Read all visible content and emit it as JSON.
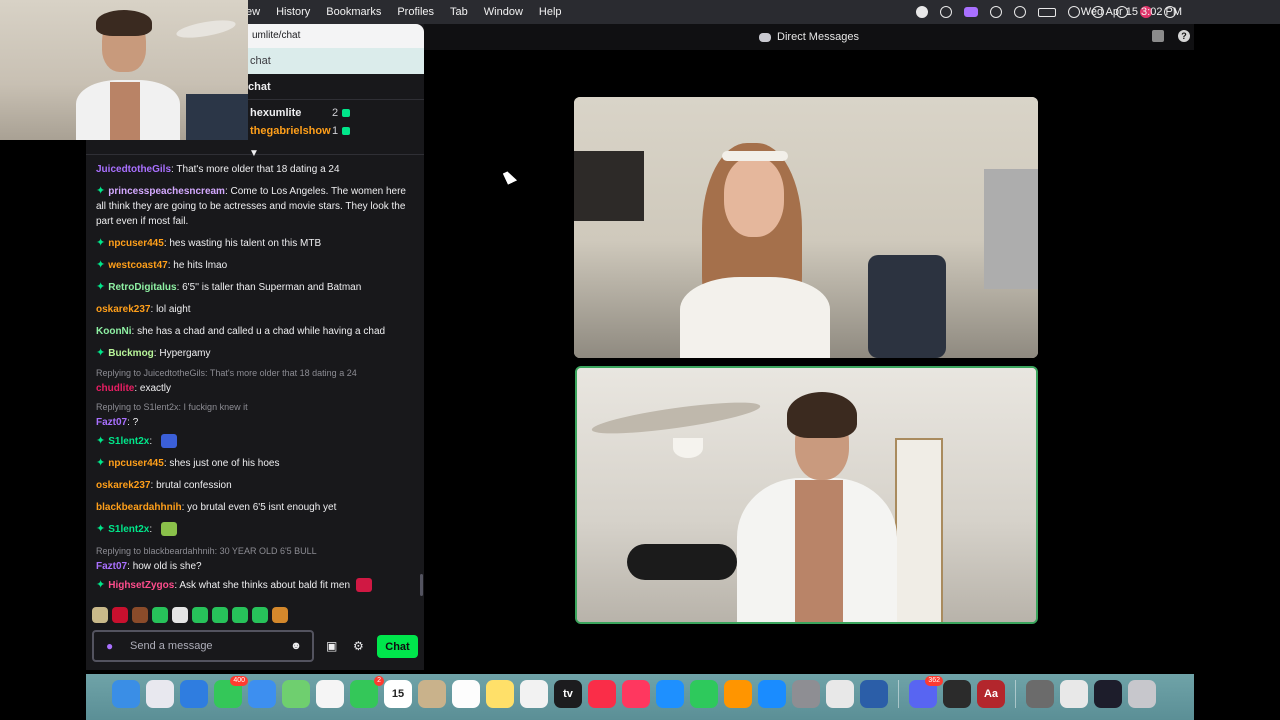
{
  "menubar": {
    "items": [
      "ew",
      "History",
      "Bookmarks",
      "Profiles",
      "Tab",
      "Window",
      "Help"
    ],
    "clock": "Wed Apr 15  3:02 PM"
  },
  "window": {
    "title": "Direct Messages"
  },
  "browser": {
    "address": "umlite/chat",
    "tab_label": "chat",
    "chat_header": "chat"
  },
  "leaderboard": [
    {
      "name": "hexumlite",
      "count": "2",
      "color": "#efeff1"
    },
    {
      "name": "thegabrielshow",
      "count": "1",
      "color": "#ff9f1a"
    }
  ],
  "messages": [
    {
      "author": "JuicedtotheGils",
      "color": "#a970ff",
      "text": "That's more older that 18 dating a 24",
      "badge": false
    },
    {
      "author": "princesspeachesncream",
      "color": "#d4a9ff",
      "text": "Come to Los Angeles. The women here all think they are going to be actresses and movie stars. They look the part even if most fail.",
      "badge": true
    },
    {
      "author": "npcuser445",
      "color": "#ff9f1a",
      "text": "hes wasting his talent on this MTB",
      "badge": true
    },
    {
      "author": "westcoast47",
      "color": "#ff9f1a",
      "text": "he hits lmao",
      "badge": true
    },
    {
      "author": "RetroDigitalus",
      "color": "#8ef0a3",
      "text": "6'5'' is taller than Superman and Batman",
      "badge": true
    },
    {
      "author": "oskarek237",
      "color": "#ff9f1a",
      "text": "lol aight",
      "badge": false
    },
    {
      "author": "KoonNi",
      "color": "#8ef0a3",
      "text": "she has a chad and called u a chad while having a chad",
      "badge": false
    },
    {
      "author": "Buckmog",
      "color": "#b8f59a",
      "text": "Hypergamy",
      "badge": true
    },
    {
      "reply": "Replying to JuicedtotheGils: That's more older that 18 dating a 24",
      "author": "chudlite",
      "color": "#e91e63",
      "text": "exactly",
      "badge": false
    },
    {
      "reply": "Replying to S1lent2x: I fuckign knew it",
      "author": "Fazt07",
      "color": "#a970ff",
      "text": "?",
      "badge": false
    },
    {
      "author": "S1lent2x",
      "color": "#00e68a",
      "text": "",
      "badge": true,
      "emote": "#3b5fd8"
    },
    {
      "author": "npcuser445",
      "color": "#ff9f1a",
      "text": "shes just one of his hoes",
      "badge": true
    },
    {
      "author": "oskarek237",
      "color": "#ff9f1a",
      "text": "brutal confession",
      "badge": false
    },
    {
      "author": "blackbeardahhnih",
      "color": "#ff9f1a",
      "text": "yo brutal even 6'5 isnt enough yet",
      "badge": false
    },
    {
      "author": "S1lent2x",
      "color": "#00e68a",
      "text": "",
      "badge": true,
      "emote": "#8ac04a"
    },
    {
      "reply": "Replying to blackbeardahhnih: 30 YEAR OLD 6'5 BULL",
      "author": "Fazt07",
      "color": "#a970ff",
      "text": "how old is she?",
      "badge": false
    },
    {
      "author": "HighsetZygos",
      "color": "#ff4d8d",
      "text": "Ask what she thinks about bald fit men",
      "badge": true,
      "emote": "#d01843"
    }
  ],
  "emote_row": [
    "#c9b98a",
    "#c8102e",
    "#8a4b2a",
    "#27c25a",
    "#e5e5e5",
    "#27c25a",
    "#27c25a",
    "#27c25a",
    "#27c25a",
    "#d4882c"
  ],
  "chat_input": {
    "placeholder": "Send a message",
    "button_label": "Chat"
  },
  "dock": [
    {
      "name": "finder",
      "color": "#3a8ee6",
      "label": "",
      "badge": ""
    },
    {
      "name": "launchpad",
      "color": "#e8e8ef",
      "label": "",
      "badge": ""
    },
    {
      "name": "safari",
      "color": "#2f7de0",
      "label": "",
      "badge": ""
    },
    {
      "name": "messages",
      "color": "#34c759",
      "label": "",
      "badge": "400"
    },
    {
      "name": "mail",
      "color": "#3d8ff0",
      "label": "",
      "badge": ""
    },
    {
      "name": "maps",
      "color": "#6fcf6f",
      "label": "",
      "badge": ""
    },
    {
      "name": "photos",
      "color": "#f5f5f5",
      "label": "",
      "badge": ""
    },
    {
      "name": "facetime",
      "color": "#34c759",
      "label": "",
      "badge": "2"
    },
    {
      "name": "calendar",
      "color": "#ffffff",
      "label": "15",
      "badge": ""
    },
    {
      "name": "contacts",
      "color": "#c9b28b",
      "label": "",
      "badge": ""
    },
    {
      "name": "reminders",
      "color": "#fdfdfd",
      "label": "",
      "badge": ""
    },
    {
      "name": "notes",
      "color": "#ffe069",
      "label": "",
      "badge": ""
    },
    {
      "name": "freeform",
      "color": "#f2f2f2",
      "label": "",
      "badge": ""
    },
    {
      "name": "tv",
      "color": "#1c1c1e",
      "label": "tv",
      "badge": ""
    },
    {
      "name": "music",
      "color": "#fa2d48",
      "label": "",
      "badge": ""
    },
    {
      "name": "news",
      "color": "#ff375f",
      "label": "",
      "badge": ""
    },
    {
      "name": "keynote",
      "color": "#1e90ff",
      "label": "",
      "badge": ""
    },
    {
      "name": "numbers",
      "color": "#2ec95c",
      "label": "",
      "badge": ""
    },
    {
      "name": "pages",
      "color": "#ff9500",
      "label": "",
      "badge": ""
    },
    {
      "name": "app-store",
      "color": "#1a8cff",
      "label": "",
      "badge": ""
    },
    {
      "name": "system-settings",
      "color": "#8e8e93",
      "label": "",
      "badge": ""
    },
    {
      "name": "chrome",
      "color": "#e8e8e8",
      "label": "",
      "badge": ""
    },
    {
      "name": "simulator",
      "color": "#2b5ea8",
      "label": "",
      "badge": ""
    },
    {
      "name": "discord",
      "color": "#5865f2",
      "label": "",
      "badge": "362"
    },
    {
      "name": "obs",
      "color": "#2b2b2b",
      "label": "",
      "badge": ""
    },
    {
      "name": "dictionary",
      "color": "#b3262c",
      "label": "Aa",
      "badge": ""
    },
    {
      "name": "preview",
      "color": "#6b6b6b",
      "label": "",
      "badge": ""
    },
    {
      "name": "document",
      "color": "#e8e8e8",
      "label": "",
      "badge": ""
    },
    {
      "name": "screenshot-folder",
      "color": "#1d1d2b",
      "label": "",
      "badge": ""
    },
    {
      "name": "trash",
      "color": "#c7c7cc",
      "label": "",
      "badge": ""
    }
  ]
}
